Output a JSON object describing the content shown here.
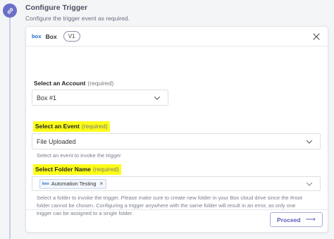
{
  "section": {
    "title": "Configure Trigger",
    "subtitle": "Configure the trigger event as required."
  },
  "panel": {
    "app_logo": "box",
    "app_name": "Box",
    "version": "V1"
  },
  "account": {
    "label": "Select an Account",
    "required": "(required)",
    "value": "Box #1"
  },
  "event": {
    "label": "Select an Event",
    "required": "(required)",
    "value": "File Uploaded",
    "help": "Select an event to invoke the trigger"
  },
  "folder": {
    "label": "Select Folder Name",
    "required": "(required)",
    "tag_logo": "box",
    "tag_value": "Automation Testing",
    "tag_remove": "×",
    "help_line1": "Select a folder to invoke the trigger. Please make sure to create new folder in your Box cloud drive since the #root",
    "help_line2": "folder cannot be chosen. Configuring a trigger anywhere with the same folder will result in an error, as only one",
    "help_line3": "trigger can be assigned to a single folder."
  },
  "footer": {
    "proceed_label": "Proceed",
    "proceed_arrow": "⟶"
  },
  "colors": {
    "accent": "#5b5fb7",
    "highlight": "#fdfd1a",
    "box_brand": "#1b6ac9"
  },
  "icons": [
    "link-icon",
    "close-icon",
    "chevron-down-icon",
    "arrow-right-icon"
  ]
}
